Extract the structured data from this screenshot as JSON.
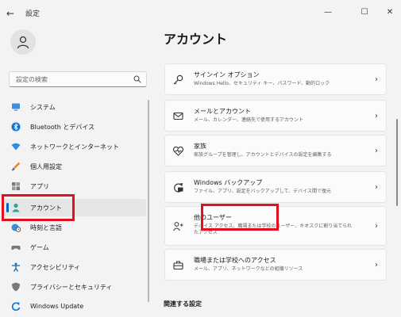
{
  "window": {
    "title": "設定",
    "minimize": "—",
    "maximize": "☐",
    "close": "✕"
  },
  "search": {
    "placeholder": "設定の検索"
  },
  "sidebar": {
    "items": [
      {
        "label": "システム",
        "icon": "monitor-icon"
      },
      {
        "label": "Bluetooth とデバイス",
        "icon": "bluetooth-icon"
      },
      {
        "label": "ネットワークとインターネット",
        "icon": "wifi-icon"
      },
      {
        "label": "個人用設定",
        "icon": "brush-icon"
      },
      {
        "label": "アプリ",
        "icon": "apps-icon"
      },
      {
        "label": "アカウント",
        "icon": "account-icon",
        "selected": true
      },
      {
        "label": "時刻と言語",
        "icon": "globe-clock-icon"
      },
      {
        "label": "ゲーム",
        "icon": "gamepad-icon"
      },
      {
        "label": "アクセシビリティ",
        "icon": "accessibility-icon"
      },
      {
        "label": "プライバシーとセキュリティ",
        "icon": "shield-icon"
      },
      {
        "label": "Windows Update",
        "icon": "update-icon"
      }
    ]
  },
  "main": {
    "title": "アカウント",
    "cards": [
      {
        "title": "サインイン オプション",
        "subtitle": "Windows Hello、セキュリティ キー、パスワード、動的ロック",
        "icon": "key-icon"
      },
      {
        "title": "メールとアカウント",
        "subtitle": "メール、カレンダー、連絡先で使用するアカウント",
        "icon": "mail-icon"
      },
      {
        "title": "家族",
        "subtitle": "家族グループを管理し、アカウントとデバイスの設定を編集する",
        "icon": "heart-icon"
      },
      {
        "title": "Windows バックアップ",
        "subtitle": "ファイル、アプリ、設定をバックアップして、デバイス間で復元",
        "icon": "backup-icon"
      },
      {
        "title": "他のユーザー",
        "subtitle": "デバイス アクセス、職場または学校のユーザー、キオスクに割り当てられたアクセス",
        "icon": "other-users-icon"
      },
      {
        "title": "職場または学校へのアクセス",
        "subtitle": "メール、アプリ、ネットワークなどの組織リソース",
        "icon": "briefcase-icon"
      }
    ],
    "related_heading": "関連する設定"
  },
  "colors": {
    "accent": "#0067c0",
    "highlight": "#e0101e"
  }
}
